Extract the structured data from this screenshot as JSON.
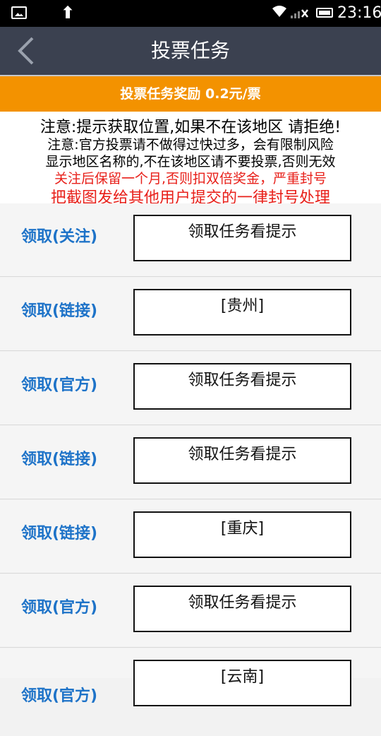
{
  "status_bar": {
    "time": "23:16",
    "icons": [
      "image-icon",
      "usb-icon",
      "wifi-icon",
      "signal-icon",
      "battery-icon"
    ]
  },
  "header": {
    "title": "投票任务",
    "back_icon": "chevron-left-icon"
  },
  "reward": {
    "text": "投票任务奖励 0.2元/票"
  },
  "notice": {
    "line1": "注意:提示获取位置,如果不在该地区 请拒绝!",
    "line2": "注意:官方投票请不做得过快过多，会有限制风险",
    "line3": "显示地区名称的,不在该地区请不要投票,否则无效",
    "line4": "关注后保留一个月,否则扣双倍奖金，严重封号",
    "line5": "把截图发给其他用户提交的一律封号处理"
  },
  "tasks": [
    {
      "label": "领取(关注)",
      "box": "领取任务看提示"
    },
    {
      "label": "领取(链接)",
      "box": "[贵州]"
    },
    {
      "label": "领取(官方)",
      "box": "领取任务看提示"
    },
    {
      "label": "领取(链接)",
      "box": "领取任务看提示"
    },
    {
      "label": "领取(链接)",
      "box": "[重庆]"
    },
    {
      "label": "领取(官方)",
      "box": "领取任务看提示"
    },
    {
      "label": "领取(官方)",
      "box": "[云南]"
    }
  ],
  "colors": {
    "status_bar": "#000000",
    "title_bar": "#3b4150",
    "reward_bar": "#f39200",
    "warning_text": "#e8201a",
    "task_label": "#1e73c8"
  }
}
